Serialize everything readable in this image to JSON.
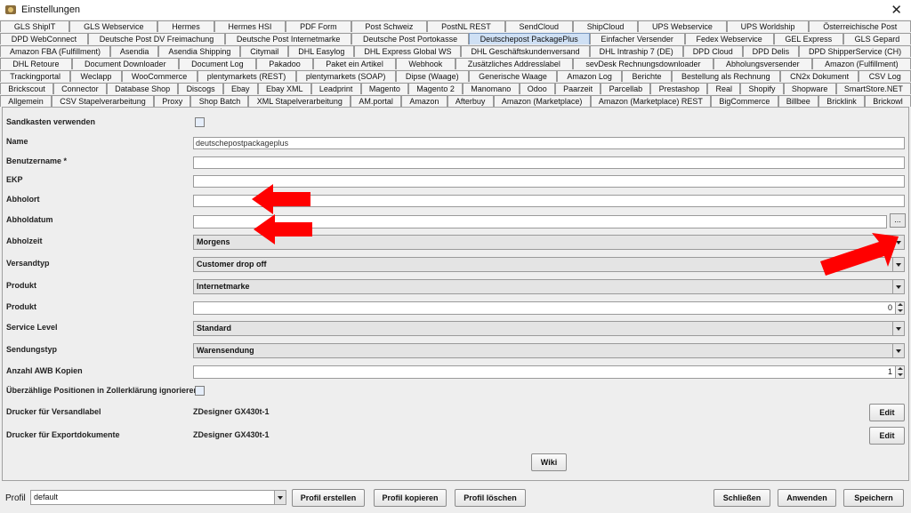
{
  "window": {
    "title": "Einstellungen",
    "close_glyph": "✕"
  },
  "tab_rows": [
    [
      "GLS ShipIT",
      "GLS Webservice",
      "Hermes",
      "Hermes HSI",
      "PDF Form",
      "Post Schweiz",
      "PostNL REST",
      "SendCloud",
      "ShipCloud",
      "UPS Webservice",
      "UPS Worldship",
      "Österreichische Post"
    ],
    [
      "DPD WebConnect",
      "Deutsche Post DV Freimachung",
      "Deutsche Post Internetmarke",
      "Deutsche Post Portokasse",
      "Deutschepost PackagePlus",
      "Einfacher Versender",
      "Fedex Webservice",
      "GEL Express",
      "GLS Gepard"
    ],
    [
      "Amazon FBA (Fulfillment)",
      "Asendia",
      "Asendia Shipping",
      "Citymail",
      "DHL Easylog",
      "DHL Express Global WS",
      "DHL Geschäftskundenversand",
      "DHL Intraship 7 (DE)",
      "DPD Cloud",
      "DPD Delis",
      "DPD ShipperService (CH)"
    ],
    [
      "DHL Retoure",
      "Document Downloader",
      "Document Log",
      "Pakadoo",
      "Paket ein Artikel",
      "Webhook",
      "Zusätzliches Addresslabel",
      "sevDesk Rechnungsdownloader",
      "Abholungsversender",
      "Amazon (Fulfillment)"
    ],
    [
      "Trackingportal",
      "Weclapp",
      "WooCommerce",
      "plentymarkets (REST)",
      "plentymarkets (SOAP)",
      "Dipse (Waage)",
      "Generische Waage",
      "Amazon Log",
      "Berichte",
      "Bestellung als Rechnung",
      "CN2x Dokument",
      "CSV Log"
    ],
    [
      "Brickscout",
      "Connector",
      "Database Shop",
      "Discogs",
      "Ebay",
      "Ebay XML",
      "Leadprint",
      "Magento",
      "Magento 2",
      "Manomano",
      "Odoo",
      "Paarzeit",
      "Parcellab",
      "Prestashop",
      "Real",
      "Shopify",
      "Shopware",
      "SmartStore.NET"
    ],
    [
      "Allgemein",
      "CSV Stapelverarbeitung",
      "Proxy",
      "Shop Batch",
      "XML Stapelverarbeitung",
      "AM.portal",
      "Amazon",
      "Afterbuy",
      "Amazon (Marketplace)",
      "Amazon (Marketplace) REST",
      "BigCommerce",
      "Billbee",
      "Bricklink",
      "Brickowl"
    ]
  ],
  "selected_tab": "Deutschepost PackagePlus",
  "form": {
    "sandbox_label": "Sandkasten verwenden",
    "name_label": "Name",
    "name_value": "deutschepostpackageplus",
    "username_label": "Benutzername *",
    "ekp_label": "EKP",
    "pickup_place_label": "Abholort",
    "pickup_date_label": "Abholdatum",
    "pickup_date_button": "...",
    "pickup_time_label": "Abholzeit",
    "pickup_time_value": "Morgens",
    "shipping_type_label": "Versandtyp",
    "shipping_type_value": "Customer drop off",
    "product_label": "Produkt",
    "product_value": "Internetmarke",
    "product_qty_label": "Produkt",
    "product_qty_value": "0",
    "service_level_label": "Service Level",
    "service_level_value": "Standard",
    "consignment_type_label": "Sendungstyp",
    "consignment_type_value": "Warensendung",
    "awb_copies_label": "Anzahl AWB Kopien",
    "awb_copies_value": "1",
    "ignore_customs_label": "Überzählige Positionen in Zollerklärung ignorieren",
    "printer_label_label": "Drucker für Versandlabel",
    "printer_label_value": "ZDesigner GX430t-1",
    "printer_export_label": "Drucker für Exportdokumente",
    "printer_export_value": "ZDesigner GX430t-1",
    "edit_label": "Edit",
    "wiki_label": "Wiki"
  },
  "bottom": {
    "profile_label": "Profil",
    "profile_value": "default",
    "create_profile": "Profil erstellen",
    "copy_profile": "Profil kopieren",
    "delete_profile": "Profil löschen",
    "close": "Schließen",
    "apply": "Anwenden",
    "save": "Speichern"
  },
  "colors": {
    "annotation_arrow": "#ff0000",
    "selected_tab": "#cfe0f4"
  }
}
